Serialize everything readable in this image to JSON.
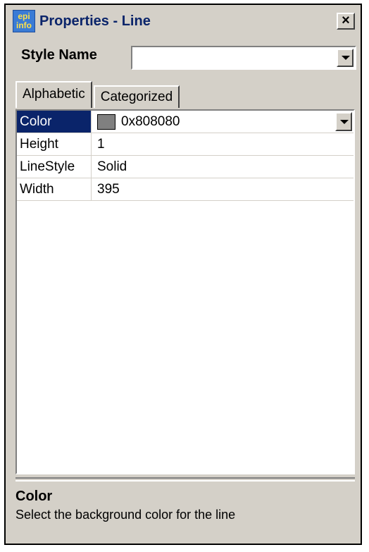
{
  "window": {
    "title": "Properties - Line",
    "icon_lines": [
      "epi",
      "info"
    ],
    "close_glyph": "×"
  },
  "style": {
    "label": "Style Name",
    "value": ""
  },
  "tabs": [
    {
      "label": "Alphabetic",
      "active": true
    },
    {
      "label": "Categorized",
      "active": false
    }
  ],
  "properties": [
    {
      "name": "Color",
      "value": "0x808080",
      "swatch": "#808080",
      "selected": true
    },
    {
      "name": "Height",
      "value": "1"
    },
    {
      "name": "LineStyle",
      "value": "Solid"
    },
    {
      "name": "Width",
      "value": "395"
    }
  ],
  "description": {
    "title": "Color",
    "text": "Select the background color for the line"
  },
  "colors": {
    "face": "#d4d0c8",
    "selection": "#0a246a",
    "title_text": "#0a246a"
  }
}
